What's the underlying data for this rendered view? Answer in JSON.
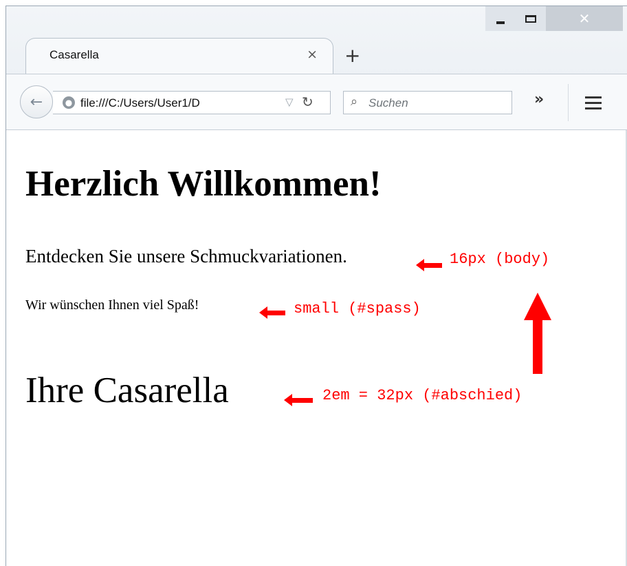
{
  "browser": {
    "tab_title": "Casarella",
    "tab_close_glyph": "×",
    "new_tab_glyph": "+",
    "url": "file:///C:/Users/User1/D",
    "search_placeholder": "Suchen",
    "overflow_glyph": "»",
    "window_controls": {
      "close_glyph": "✕"
    }
  },
  "page": {
    "heading": "Herzlich Willkommen!",
    "paragraph_body": "Entdecken Sie unsere Schmuckvariationen.",
    "paragraph_spass": "Wir wünschen Ihnen viel Spaß!",
    "paragraph_abschied": "Ihre Casarella"
  },
  "annotations": {
    "body_note": "16px (body)",
    "spass_note": "small (#spass)",
    "abschied_note": "2em = 32px (#abschied)",
    "color": "#ff0000"
  },
  "icons": {
    "back": "arrow-left-icon",
    "globe": "globe-icon",
    "dropdown": "triangle-down-icon",
    "reload": "reload-icon",
    "search": "magnifier-icon",
    "menu": "hamburger-icon"
  }
}
